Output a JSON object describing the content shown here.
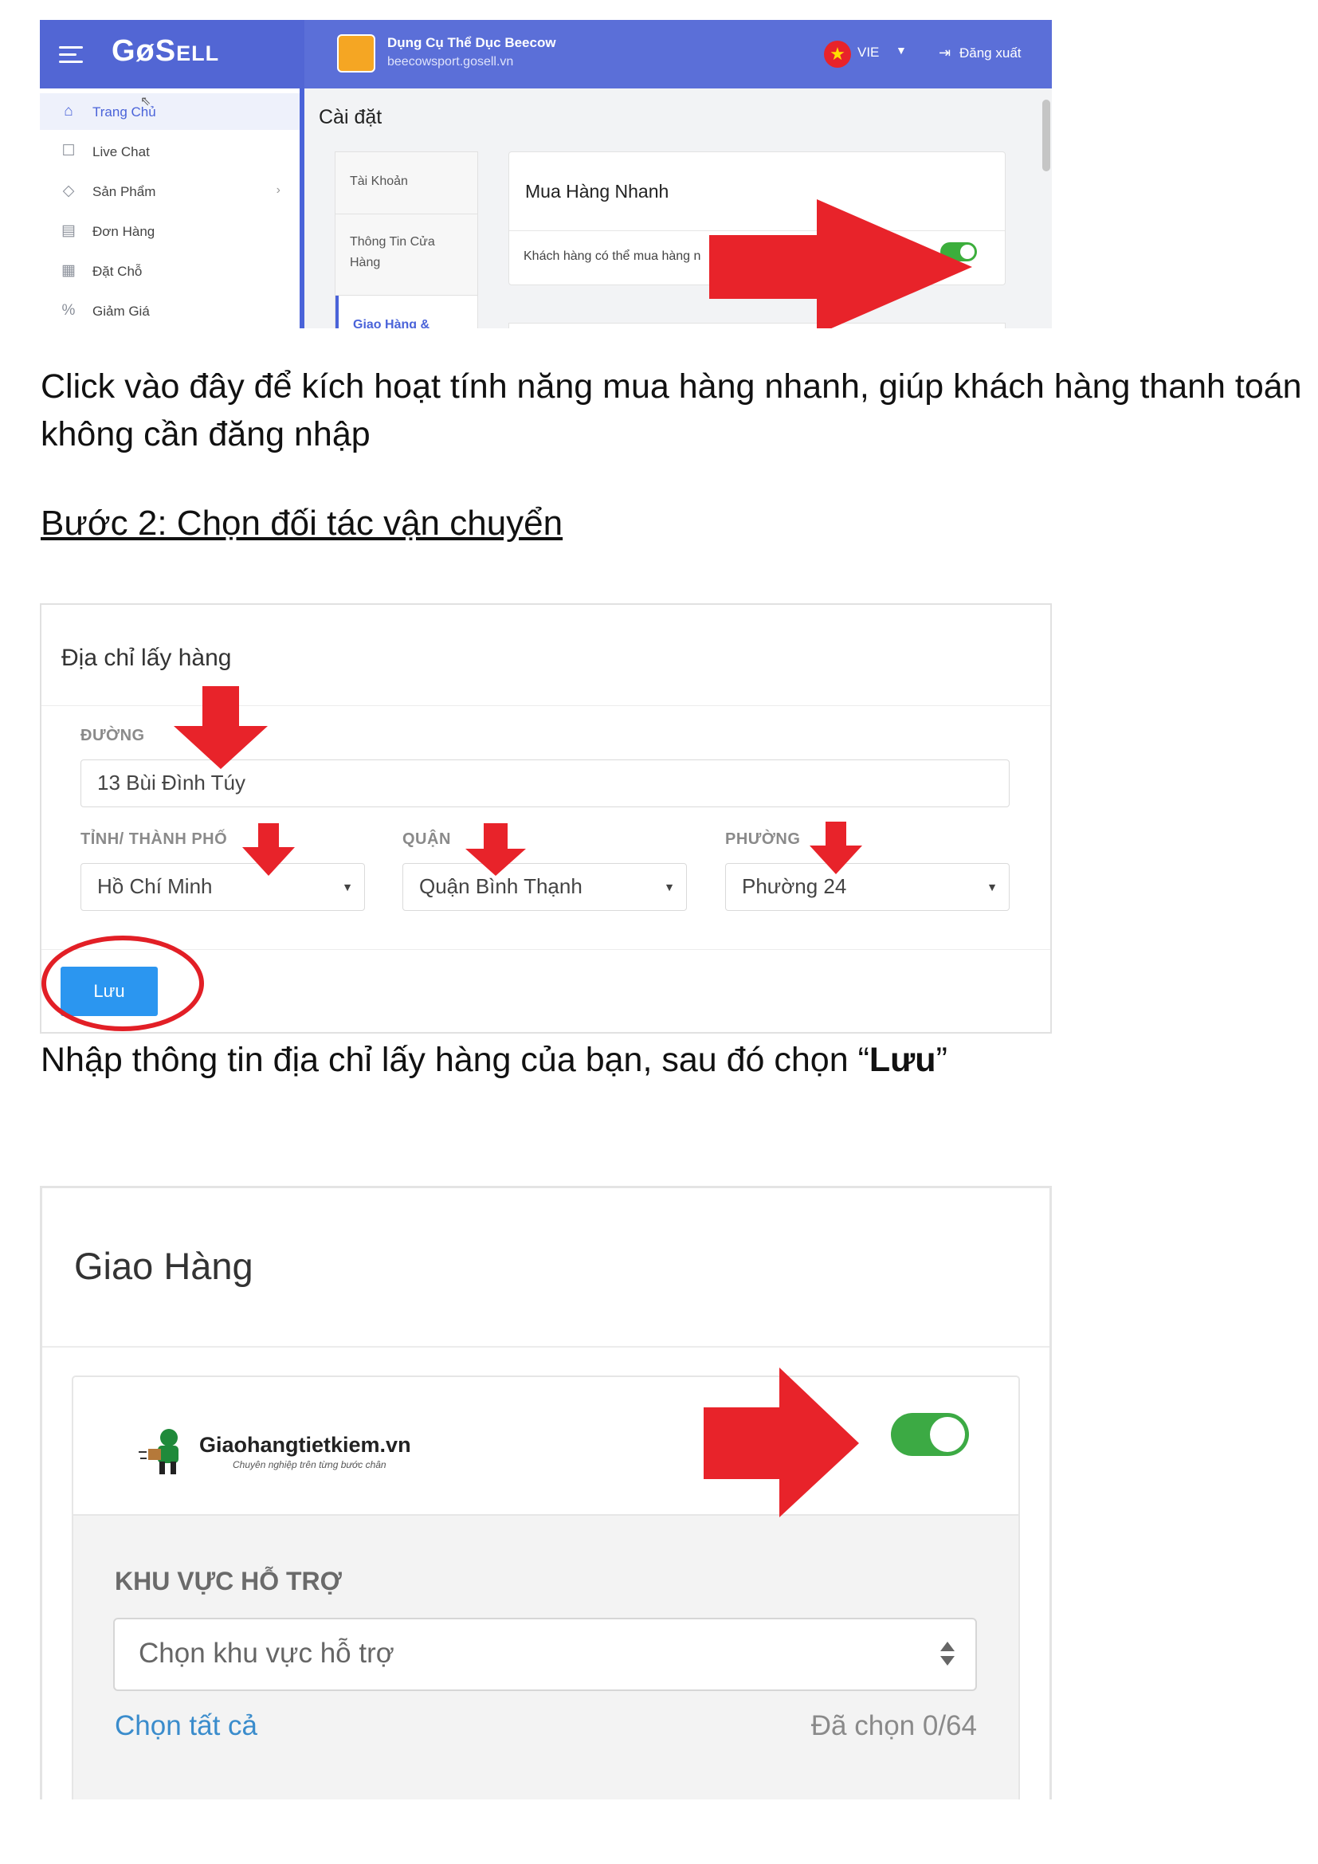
{
  "shot1": {
    "logo_main": "GøS",
    "logo_rest": "ELL",
    "shop_name": "Dụng Cụ Thể Dục Beecow",
    "shop_url": "beecowsport.gosell.vn",
    "flag_icon": "★",
    "lang": "VIE",
    "logout": "Đăng xuất",
    "sidebar": [
      {
        "label": "Trang Chủ",
        "icon": "⌂"
      },
      {
        "label": "Live Chat",
        "icon": "☐"
      },
      {
        "label": "Sản Phẩm",
        "icon": "◇"
      },
      {
        "label": "Đơn Hàng",
        "icon": "▤"
      },
      {
        "label": "Đặt Chỗ",
        "icon": "▦"
      },
      {
        "label": "Giảm Giá",
        "icon": "%"
      }
    ],
    "settings_title": "Cài đặt",
    "tabs": [
      "Tài Khoản",
      "Thông Tin Cửa Hàng",
      "Giao Hàng &"
    ],
    "card_title": "Mua Hàng Nhanh",
    "card_desc": "Khách hàng có thể mua hàng n"
  },
  "para1": "Click vào đây để kích hoạt tính năng mua hàng nhanh, giúp khách hàng thanh toán không cần đăng nhập",
  "step2": "Bước 2: Chọn đối tác vận chuyển ",
  "shot2": {
    "title": "Địa chỉ lấy hàng",
    "street_label": "ĐƯỜNG",
    "street_value": "13 Bùi Đình Túy",
    "city_label": "TỈNH/ THÀNH PHỐ",
    "city_value": "Hồ Chí Minh",
    "district_label": "QUẬN",
    "district_value": "Quận Bình Thạnh",
    "ward_label": "PHƯỜNG",
    "ward_value": "Phường 24",
    "save": "Lưu"
  },
  "para2_pre": "Nhập thông tin địa chỉ lấy hàng của bạn, sau đó chọn  “",
  "para2_bold": "Lưu",
  "para2_post": "”",
  "shot3": {
    "title": "Giao Hàng",
    "provider": "Giaohangtietkiem.vn",
    "provider_tagline": "Chuyên nghiệp trên từng bước chân",
    "region_label": "KHU VỰC HỖ TRỢ",
    "region_placeholder": "Chọn khu vực hỗ trợ",
    "select_all": "Chọn tất cả",
    "selected_count": "Đã chọn 0/64"
  },
  "colors": {
    "brand_blue": "#5b6fd8",
    "arrow_red": "#e8232a",
    "toggle_green": "#3caa44",
    "save_blue": "#2b96f0"
  }
}
